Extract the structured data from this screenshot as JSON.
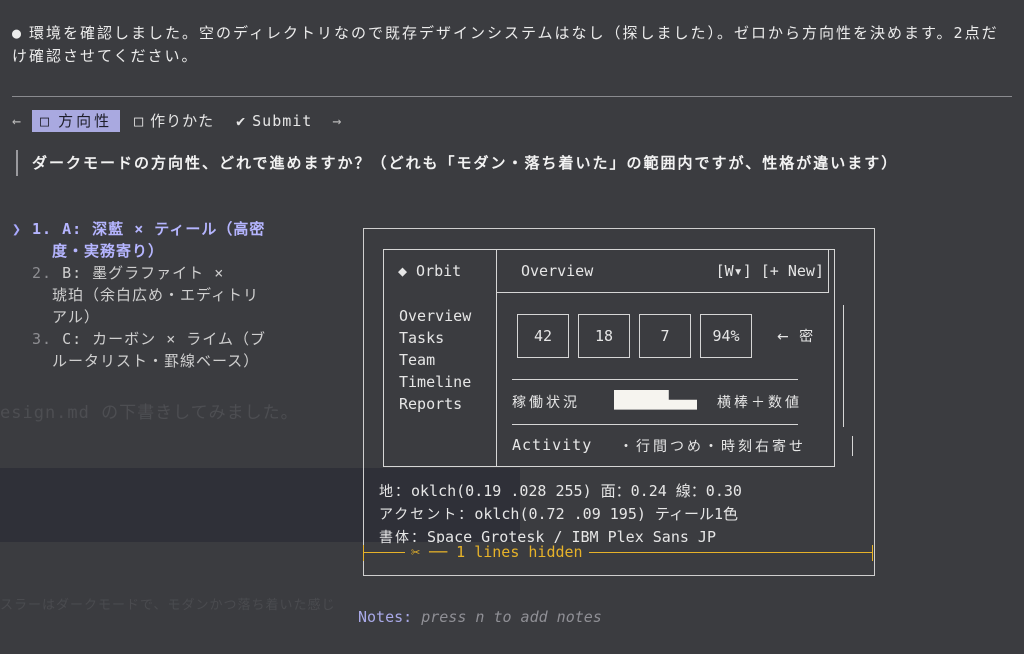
{
  "intro": {
    "bullet": "●",
    "text": "環境を確認しました。空のディレクトリなので既存デザインシステムはなし（探しました）。ゼロから方向性を決めます。2点だけ確認させてください。"
  },
  "tabs": {
    "prev_arrow": "←",
    "next_arrow": "→",
    "items": [
      {
        "box": "□",
        "label": "方向性"
      },
      {
        "box": "□",
        "label": "作りかた"
      },
      {
        "box": "✔",
        "label": "Submit"
      }
    ]
  },
  "question": "ダークモードの方向性、どれで進めますか？（どれも「モダン・落ち着いた」の範囲内ですが、性格が違います）",
  "options": [
    {
      "caret": "❯",
      "num": "1.",
      "line1": "A: 深藍 × ティール（高密",
      "line2": "度・実務寄り）"
    },
    {
      "num": "2.",
      "line1": "B: 墨グラファイト ×",
      "line2": "琥珀（余白広め・エディトリ",
      "line3": "アル）"
    },
    {
      "num": "3.",
      "line1": "C: カーボン × ライム（ブ",
      "line2": "ルータリスト・罫線ベース）"
    }
  ],
  "ghost": {
    "line1": "esign.md の下書きしてみました。",
    "line2": "スラーはダークモードで、モダンかつ落ち着いた感じ"
  },
  "preview": {
    "brand": "◆ Orbit",
    "nav": [
      "Overview",
      "Tasks",
      "Team",
      "Timeline",
      "Reports"
    ],
    "header_title": "Overview",
    "header_actions": "[W▾] [+ New]",
    "kpis": [
      "42",
      "18",
      "7",
      "94%"
    ],
    "density_note": "← 密",
    "status_label": "稼働状況",
    "status_level": 0.55,
    "status_note": "横棒＋数値",
    "activity_label": "Activity",
    "activity_note": "・行間つめ・時刻右寄せ",
    "specs": [
      {
        "key": "地：",
        "value": "oklch(0.19 .028 255)  面：0.24  線：0.30"
      },
      {
        "key": "アクセント：",
        "value": "oklch(0.72 .09 195) ティール1色"
      },
      {
        "key": "書体：",
        "value": "Space Grotesk / IBM Plex Sans JP"
      }
    ],
    "hidden": "✂ ── 1 lines hidden"
  },
  "notes": {
    "label": "Notes:",
    "hint": "press n to add notes"
  },
  "colors": {
    "background": "#3b3c40",
    "accent": "#a9a9e0",
    "warning": "#e6b229"
  }
}
